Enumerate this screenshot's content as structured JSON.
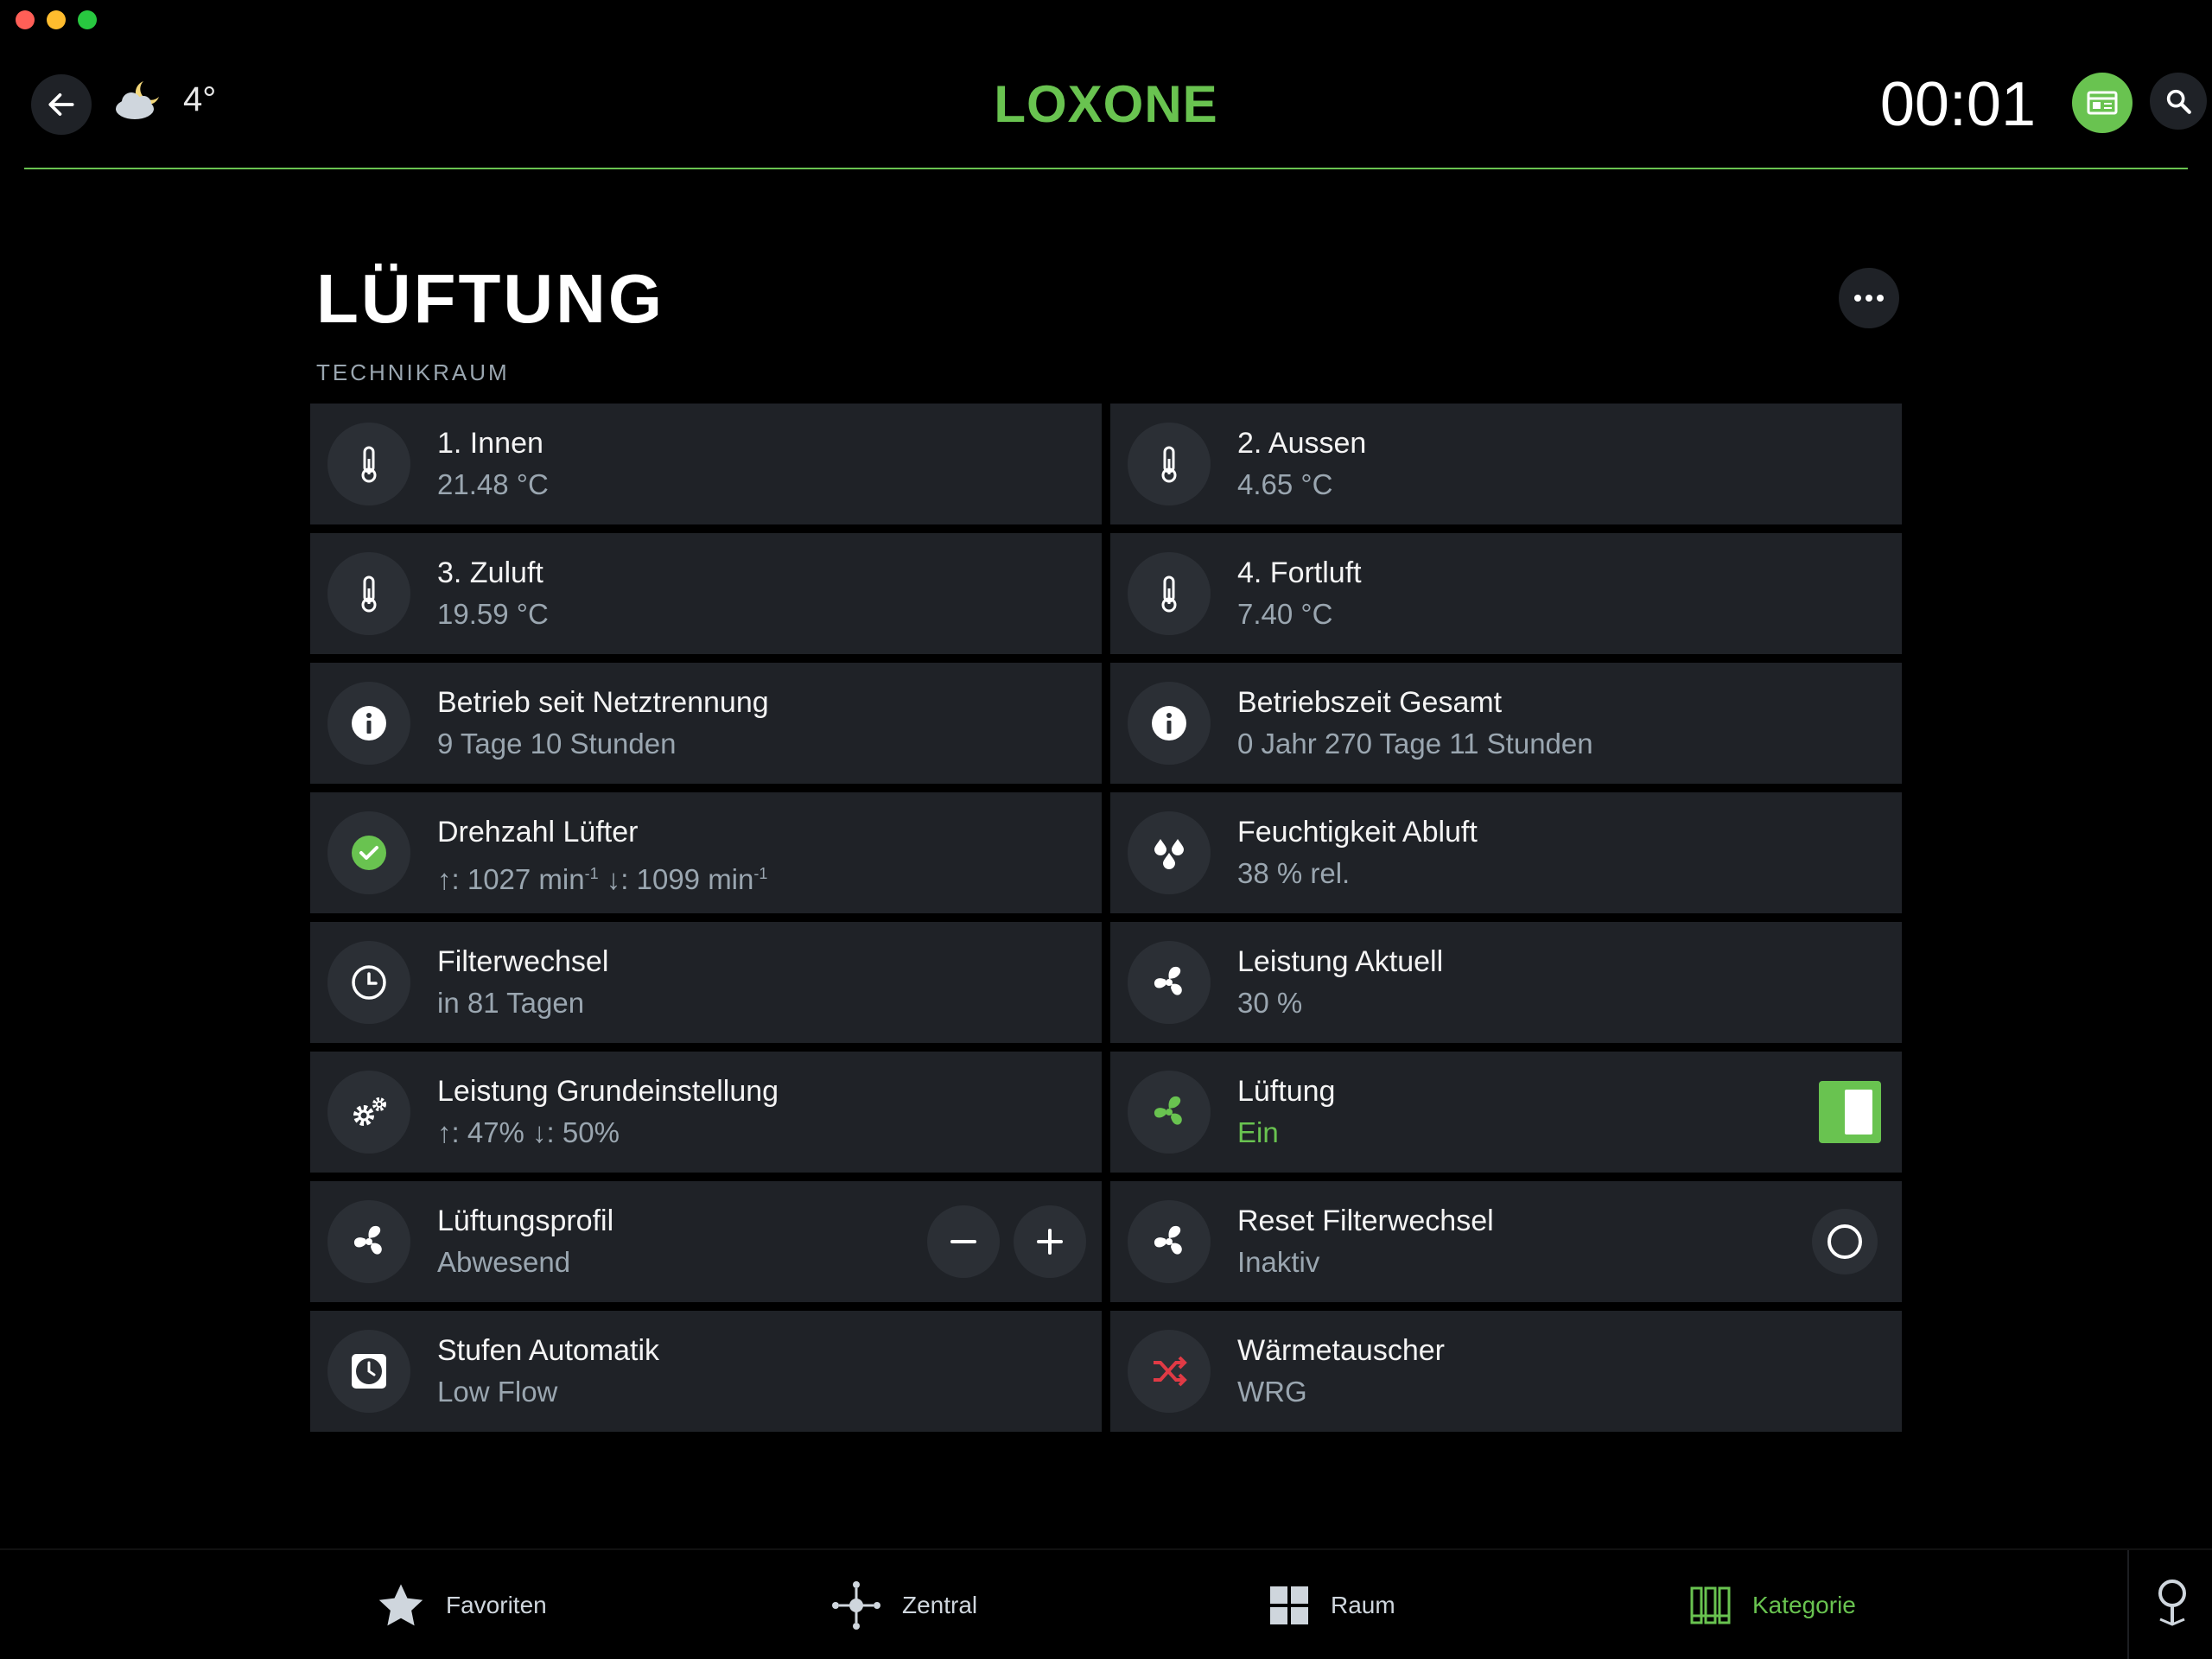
{
  "header": {
    "brand": "LOXONE",
    "weather_temp": "4°",
    "clock": "00:01"
  },
  "page": {
    "title": "LÜFTUNG",
    "subtitle": "TECHNIKRAUM"
  },
  "cards": {
    "innen": {
      "title": "1. Innen",
      "value": "21.48 °C",
      "icon": "thermometer-icon"
    },
    "aussen": {
      "title": "2. Aussen",
      "value": "4.65 °C",
      "icon": "thermometer-icon"
    },
    "zuluft": {
      "title": "3. Zuluft",
      "value": "19.59 °C",
      "icon": "thermometer-icon"
    },
    "fortluft": {
      "title": "4. Fortluft",
      "value": "7.40 °C",
      "icon": "thermometer-icon"
    },
    "betrieb": {
      "title": "Betrieb seit Netztrennung",
      "value": "9 Tage 10 Stunden",
      "icon": "info-icon"
    },
    "betriebszeit": {
      "title": "Betriebszeit Gesamt",
      "value": "0 Jahr 270 Tage 11 Stunden",
      "icon": "info-icon"
    },
    "drehzahl": {
      "title": "Drehzahl Lüfter",
      "up": "↑: 1027 min",
      "down": " ↓: 1099 min",
      "exp": "-1",
      "icon": "check-icon"
    },
    "feuchtigkeit": {
      "title": "Feuchtigkeit Abluft",
      "value": "38 % rel.",
      "icon": "droplets-icon"
    },
    "filterwechsel": {
      "title": "Filterwechsel",
      "value": "in 81 Tagen",
      "icon": "clock-icon"
    },
    "leistung_aktuell": {
      "title": "Leistung Aktuell",
      "value": "30 %",
      "icon": "fan-icon"
    },
    "grundeinstellung": {
      "title": "Leistung Grundeinstellung",
      "value": "↑: 47% ↓: 50%",
      "icon": "gears-icon"
    },
    "lueftung": {
      "title": "Lüftung",
      "value": "Ein",
      "icon": "fan-icon",
      "state": "on",
      "accent": "#69c350"
    },
    "profil": {
      "title": "Lüftungsprofil",
      "value": "Abwesend",
      "icon": "fan-icon"
    },
    "reset_filter": {
      "title": "Reset Filterwechsel",
      "value": "Inaktiv",
      "icon": "fan-icon"
    },
    "stufen": {
      "title": "Stufen Automatik",
      "value": "Low Flow",
      "icon": "timer-icon"
    },
    "waermetauscher": {
      "title": "Wärmetauscher",
      "value": "WRG",
      "icon": "shuffle-icon",
      "accent": "#e03a45"
    }
  },
  "tabs": [
    {
      "label": "Favoriten",
      "icon": "star-icon"
    },
    {
      "label": "Zentral",
      "icon": "central-icon"
    },
    {
      "label": "Raum",
      "icon": "grid-icon"
    },
    {
      "label": "Kategorie",
      "icon": "category-icon",
      "active": true
    }
  ],
  "colors": {
    "accent": "#69c350",
    "card": "#1f2227",
    "muted": "#9aa6b0",
    "alert": "#e03a45"
  }
}
